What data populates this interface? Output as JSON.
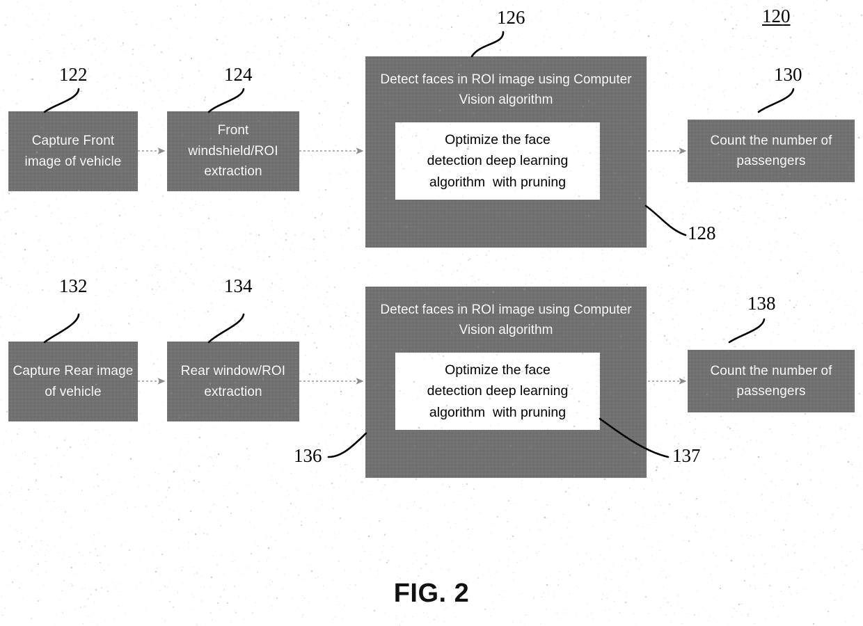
{
  "figure": {
    "caption": "FIG. 2",
    "figure_ref": "120"
  },
  "refs": {
    "r120": "120",
    "r122": "122",
    "r124": "124",
    "r126": "126",
    "r128": "128",
    "r130": "130",
    "r132": "132",
    "r134": "134",
    "r136": "136",
    "r137": "137",
    "r138": "138"
  },
  "rows": [
    {
      "name": "front-pipeline",
      "boxes": {
        "capture": "Capture Front image of vehicle",
        "roi": "Front windshield/ROI extraction",
        "stage_header": "Detect faces in ROI image using Computer Vision algorithm",
        "stage_inner": "Optimize the face\ndetection deep learning\nalgorithm  with pruning",
        "count": "Count the number of passengers"
      }
    },
    {
      "name": "rear-pipeline",
      "boxes": {
        "capture": "Capture Rear image of vehicle",
        "roi": "Rear window/ROI extraction",
        "stage_header": "Detect faces in ROI image using Computer Vision algorithm",
        "stage_inner": "Optimize the face\ndetection deep learning\nalgorithm  with pruning",
        "count": "Count the number of passengers"
      }
    }
  ],
  "colors": {
    "box_fill": "#6e6e6e",
    "box_text": "#ffffff",
    "inner_fill": "#ffffff",
    "inner_text": "#000000",
    "leader_line": "#000000",
    "connector": "#9a9a9a",
    "page_background": "#ffffff"
  }
}
